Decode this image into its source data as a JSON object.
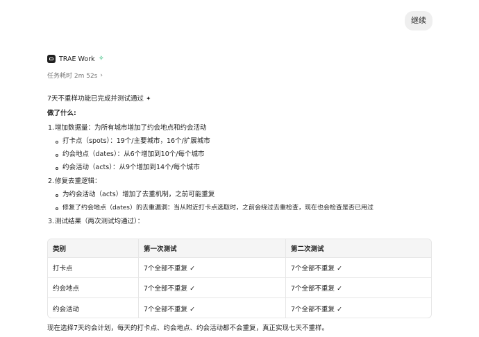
{
  "user_message": {
    "text": "继续"
  },
  "agent": {
    "name": "TRAE Work",
    "duration": "任务耗时 2m 52s"
  },
  "response": {
    "headline": "7天不重样功能已完成并测试通过",
    "section_title": "做了什么:",
    "items": [
      {
        "number": "1.",
        "label": "增加数据量：为所有城市增加了约会地点和约会活动",
        "subs": [
          "打卡点（spots）：19个/主要城市，16个/扩展城市",
          "约会地点（dates）：从6个增加到10个/每个城市",
          "约会活动（acts）：从9个增加到14个/每个城市"
        ]
      },
      {
        "number": "2.",
        "label": "修复去重逻辑：",
        "subs": [
          "为约会活动（acts）增加了去重机制，之前可能重复",
          "修复了约会地点（dates）的去重漏洞：当从附近打卡点选取时，之前会绕过去重检查，现在也会检查是否已用过"
        ]
      },
      {
        "number": "3.",
        "label": "测试结果（两次测试均通过）："
      }
    ],
    "table": {
      "headers": [
        "类别",
        "第一次测试",
        "第二次测试"
      ],
      "rows": [
        [
          "打卡点",
          "7个全部不重复 ✓",
          "7个全部不重复 ✓"
        ],
        [
          "约会地点",
          "7个全部不重复 ✓",
          "7个全部不重复 ✓"
        ],
        [
          "约会活动",
          "7个全部不重复 ✓",
          "7个全部不重复 ✓"
        ]
      ]
    },
    "footer": "现在选择7天约会计划，每天的打卡点、约会地点、约会活动都不会重复，真正实现七天不重样。"
  },
  "icons": {
    "logo": "trae-logo-icon",
    "badge": "sparkle-badge-icon",
    "chevron": "chevron-right-icon",
    "headline_mark": "sparkle-icon"
  },
  "colors": {
    "badge": "#19b36b",
    "bubble": "#efefef",
    "table_header": "#f5f5f5"
  }
}
